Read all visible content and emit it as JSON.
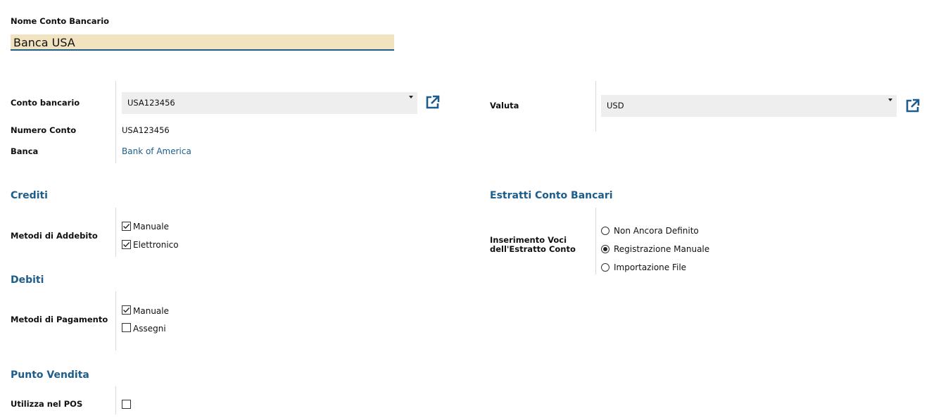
{
  "header": {
    "name_label": "Nome Conto Bancario",
    "name_value": "Banca USA"
  },
  "account": {
    "conto_label": "Conto bancario",
    "conto_value": "USA123456",
    "numero_label": "Numero Conto",
    "numero_value": "USA123456",
    "banca_label": "Banca",
    "banca_value": "Bank of America",
    "valuta_label": "Valuta",
    "valuta_value": "USD"
  },
  "crediti": {
    "title": "Crediti",
    "label": "Metodi di Addebito",
    "options": [
      {
        "label": "Manuale",
        "checked": true
      },
      {
        "label": "Elettronico",
        "checked": true
      }
    ]
  },
  "debiti": {
    "title": "Debiti",
    "label": "Metodi di Pagamento",
    "options": [
      {
        "label": "Manuale",
        "checked": true
      },
      {
        "label": "Assegni",
        "checked": false
      }
    ]
  },
  "pos": {
    "title": "Punto Vendita",
    "label": "Utilizza nel POS",
    "checked": false
  },
  "estratti": {
    "title": "Estratti Conto Bancari",
    "label_line1": "Inserimento Voci",
    "label_line2": "dell'Estratto Conto",
    "options": [
      {
        "label": "Non Ancora Definito",
        "selected": false
      },
      {
        "label": "Registrazione Manuale",
        "selected": true
      },
      {
        "label": "Importazione File",
        "selected": false
      }
    ]
  },
  "colors": {
    "accent": "#1d5d8c",
    "name_field_bg": "#f1e3bf",
    "select_bg": "#eeeeee"
  },
  "icons": {
    "external_link": "external-link-icon",
    "dropdown": "chevron-down-icon"
  }
}
